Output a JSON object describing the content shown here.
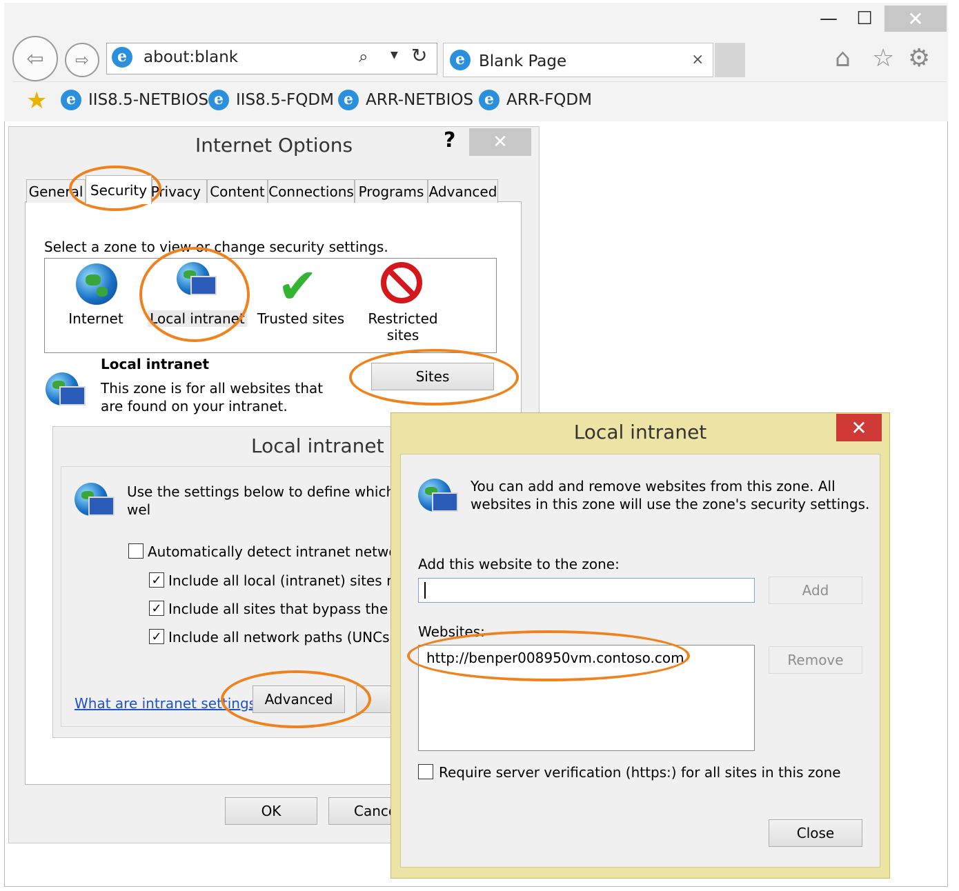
{
  "browser": {
    "window_controls": {
      "minimize": "—",
      "maximize": "☐",
      "close": "✕"
    },
    "address": "about:blank",
    "tab_title": "Blank Page",
    "tab_close": "×",
    "favorites": [
      "IIS8.5-NETBIOS",
      "IIS8.5-FQDM",
      "ARR-NETBIOS",
      "ARR-FQDM"
    ]
  },
  "internet_options": {
    "title": "Internet Options",
    "help": "?",
    "close": "✕",
    "tabs": [
      "General",
      "Security",
      "Privacy",
      "Content",
      "Connections",
      "Programs",
      "Advanced"
    ],
    "active_tab": "Security",
    "zone_prompt": "Select a zone to view or change security settings.",
    "zones": [
      "Internet",
      "Local intranet",
      "Trusted sites",
      "Restricted sites"
    ],
    "selected_zone": {
      "name": "Local intranet",
      "description": "This zone is for all websites that are found on your intranet."
    },
    "sites_button": "Sites",
    "ok_button": "OK",
    "cancel_button": "Cance"
  },
  "local_intranet_settings": {
    "title": "Local intranet",
    "description": "Use the settings below to define which wel\nthe local intranet zone.",
    "options": [
      {
        "label": "Automatically detect intranet network",
        "checked": false
      },
      {
        "label": "Include all local (intranet) sites not l",
        "checked": true
      },
      {
        "label": "Include all sites that bypass the prox",
        "checked": true
      },
      {
        "label": "Include all network paths (UNCs)",
        "checked": true
      }
    ],
    "help_link": "What are intranet settings?",
    "advanced_button": "Advanced"
  },
  "local_intranet_sites": {
    "title": "Local intranet",
    "close": "✕",
    "description": "You can add and remove websites from this zone. All websites in this zone will use the zone's security settings.",
    "add_label": "Add this website to the zone:",
    "input_value": "",
    "add_button": "Add",
    "websites_label": "Websites:",
    "websites": [
      "http://benper008950vm.contoso.com"
    ],
    "remove_button": "Remove",
    "require_https_label": "Require server verification (https:) for all sites in this zone",
    "require_https_checked": false,
    "close_button": "Close"
  },
  "colors": {
    "annotation": "#f0821e",
    "close_red": "#cf3a36",
    "dialog_frame": "#ece3a4",
    "link": "#1f52c9"
  },
  "icons": [
    "back-icon",
    "forward-icon",
    "search-icon",
    "refresh-icon",
    "ie-icon",
    "home-icon",
    "star-icon",
    "gear-icon",
    "globe-icon",
    "intranet-icon",
    "checkmark-icon",
    "restricted-icon"
  ]
}
